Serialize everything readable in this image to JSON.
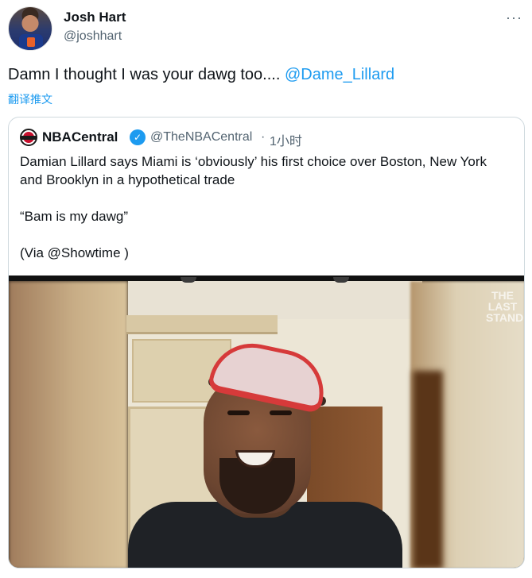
{
  "author": {
    "display_name": "Josh Hart",
    "handle": "@joshhart",
    "more_icon": "···"
  },
  "tweet": {
    "text": "Damn I thought I was your dawg too.... ",
    "mention": "@Dame_Lillard",
    "translate_label": "翻译推文"
  },
  "quote": {
    "display_name": "NBACentral",
    "verified_icon": "✓",
    "handle": "@TheNBACentral",
    "separator": "·",
    "time": "1小时",
    "paragraphs": [
      "Damian Lillard says Miami is ‘obviously’ his first choice over Boston, New York and Brooklyn in a hypothetical trade",
      "“Bam is my dawg”",
      "(Via @Showtime )"
    ],
    "watermark": "THE LAST STAND"
  }
}
